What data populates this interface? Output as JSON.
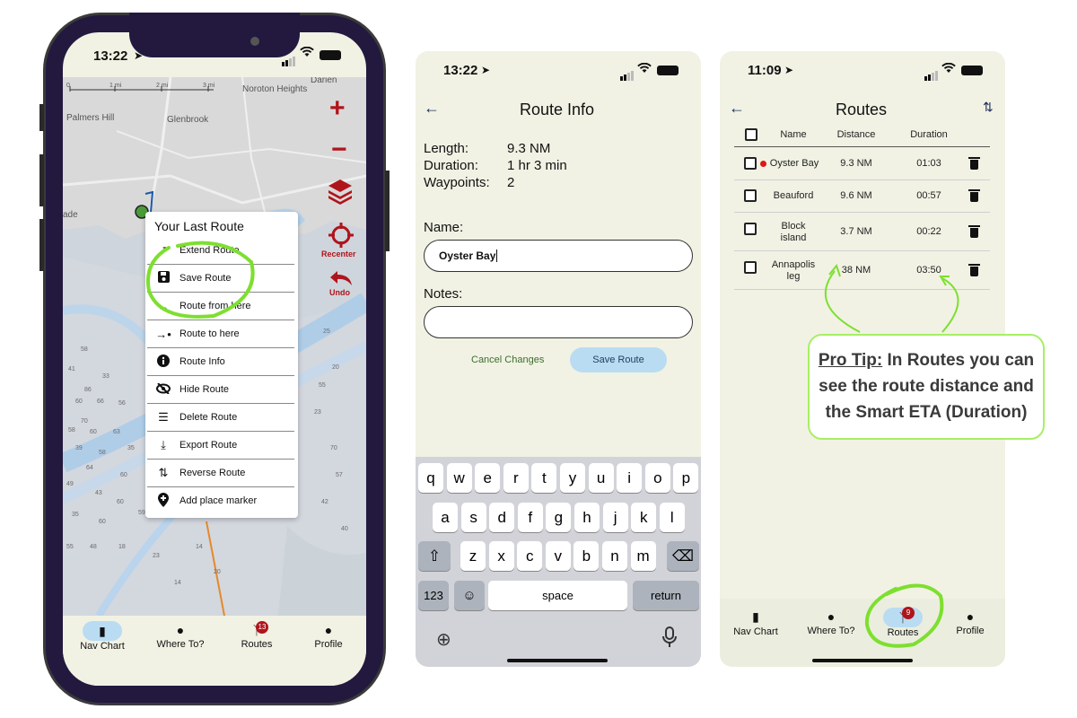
{
  "colors": {
    "accent_green": "#7ddf2f",
    "brand_red": "#b0141b",
    "pill_blue": "#b9dcf2",
    "bg": "#f1f2e4"
  },
  "phone1": {
    "status_time": "13:22",
    "map_labels": {
      "scale_0": "0",
      "scale_1": "1 mi",
      "scale_2": "2 mi",
      "scale_3": "3 mi",
      "place_noroton": "Noroton Heights",
      "place_darien": "Darien",
      "place_palmers": "Palmers Hill",
      "place_glenbrook": "Glenbrook",
      "place_ade": "ade"
    },
    "depths": [
      "58",
      "41",
      "86",
      "33",
      "60",
      "66",
      "56",
      "70",
      "58",
      "60",
      "63",
      "35",
      "39",
      "58",
      "64",
      "60",
      "49",
      "43",
      "60",
      "59",
      "35",
      "60",
      "55",
      "48",
      "18",
      "23",
      "14",
      "20",
      "14",
      "25",
      "20",
      "55",
      "23",
      "70",
      "57",
      "42",
      "40"
    ],
    "controls": {
      "zoom_in": "+",
      "zoom_out": "−",
      "layers_icon": "layers-icon",
      "recenter": "Recenter",
      "undo": "Undo"
    },
    "menu": {
      "title": "Your Last Route",
      "items": [
        {
          "label": "Extend Route",
          "icon": "trend-icon"
        },
        {
          "label": "Save Route",
          "icon": "save-icon"
        },
        {
          "label": "Route from here",
          "icon": "arrow-right-icon"
        },
        {
          "label": "Route to here",
          "icon": "arrow-to-point-icon"
        },
        {
          "label": "Route Info",
          "icon": "info-icon"
        },
        {
          "label": "Hide Route",
          "icon": "eye-slash-icon"
        },
        {
          "label": "Delete Route",
          "icon": "delete-list-icon"
        },
        {
          "label": "Export Route",
          "icon": "download-icon"
        },
        {
          "label": "Reverse Route",
          "icon": "swap-vertical-icon"
        },
        {
          "label": "Add place marker",
          "icon": "pin-plus-icon"
        }
      ]
    },
    "nav": {
      "items": [
        "Nav Chart",
        "Where To?",
        "Routes",
        "Profile"
      ],
      "routes_badge": "13"
    }
  },
  "phone2": {
    "status_time": "13:22",
    "title": "Route Info",
    "length_label": "Length:",
    "length_value": "9.3 NM",
    "duration_label": "Duration:",
    "duration_value": "1 hr 3 min",
    "waypoints_label": "Waypoints:",
    "waypoints_value": "2",
    "name_label": "Name:",
    "name_value": "Oyster Bay",
    "notes_label": "Notes:",
    "notes_value": "",
    "cancel": "Cancel Changes",
    "save": "Save Route",
    "keyboard": {
      "row1": [
        "q",
        "w",
        "e",
        "r",
        "t",
        "y",
        "u",
        "i",
        "o",
        "p"
      ],
      "row2": [
        "a",
        "s",
        "d",
        "f",
        "g",
        "h",
        "j",
        "k",
        "l"
      ],
      "row3": [
        "z",
        "x",
        "c",
        "v",
        "b",
        "n",
        "m"
      ],
      "num": "123",
      "space": "space",
      "return": "return"
    }
  },
  "phone3": {
    "status_time": "11:09",
    "title": "Routes",
    "headers": {
      "name": "Name",
      "distance": "Distance",
      "duration": "Duration"
    },
    "rows": [
      {
        "name": "Oyster Bay",
        "distance": "9.3 NM",
        "duration": "01:03",
        "active": true
      },
      {
        "name": "Beauford",
        "distance": "9.6 NM",
        "duration": "00:57",
        "active": false
      },
      {
        "name": "Block island",
        "distance": "3.7 NM",
        "duration": "00:22",
        "active": false
      },
      {
        "name": "Annapolis leg",
        "distance": "38 NM",
        "duration": "03:50",
        "active": false
      }
    ],
    "nav": {
      "items": [
        "Nav Chart",
        "Where To?",
        "Routes",
        "Profile"
      ],
      "routes_badge": "9"
    }
  },
  "tip": {
    "prefix": "Pro Tip:",
    "line1": " In Routes you can",
    "line2": "see the route distance and",
    "line3": "the Smart ETA (Duration)"
  }
}
